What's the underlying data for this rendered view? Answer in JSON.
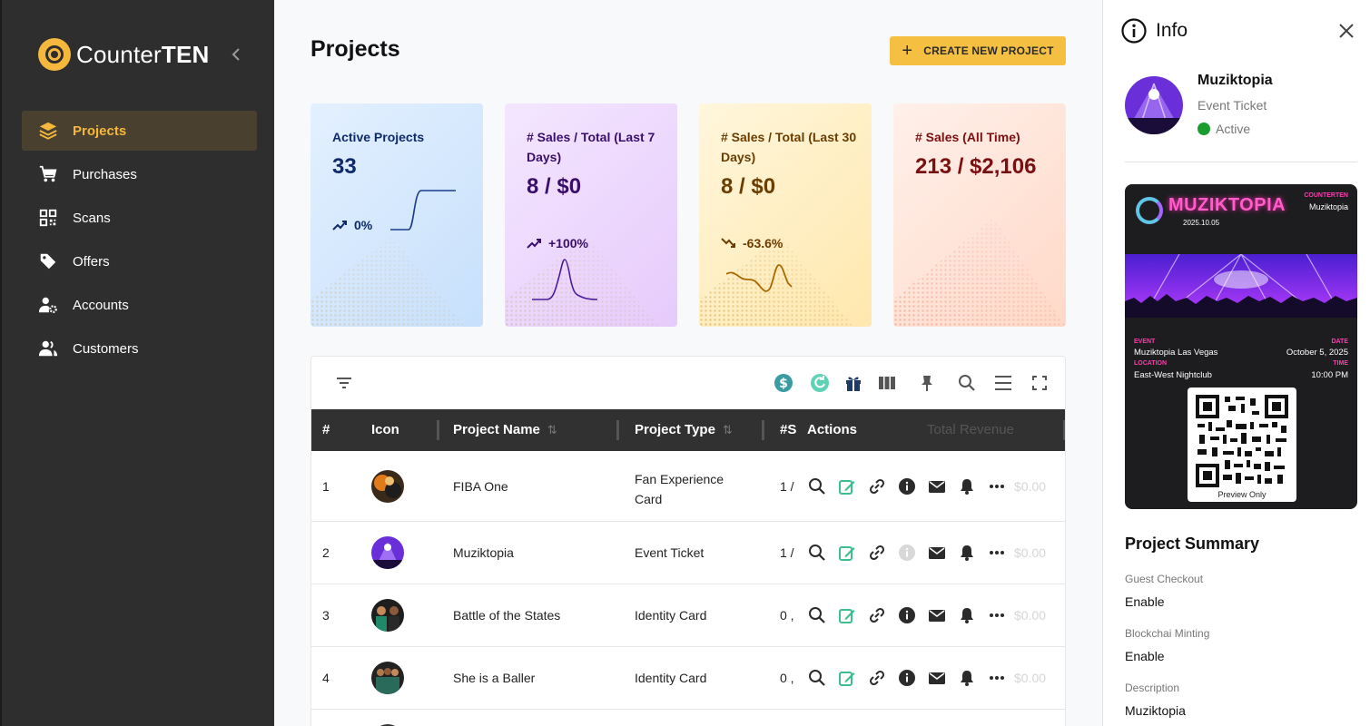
{
  "app": {
    "logo_light": "Counter",
    "logo_bold": "TEN"
  },
  "sidebar": {
    "items": [
      {
        "label": "Projects",
        "icon": "layers-icon",
        "active": true
      },
      {
        "label": "Purchases",
        "icon": "cart-icon"
      },
      {
        "label": "Scans",
        "icon": "qr-icon"
      },
      {
        "label": "Offers",
        "icon": "tag-icon"
      },
      {
        "label": "Accounts",
        "icon": "user-gear-icon"
      },
      {
        "label": "Customers",
        "icon": "users-icon"
      }
    ]
  },
  "header": {
    "title": "Projects",
    "create_label": "CREATE NEW PROJECT"
  },
  "stats": [
    {
      "title": "Active Projects",
      "value": "33",
      "delta": "0%"
    },
    {
      "title": "# Sales / Total (Last 7 Days)",
      "value": "8 / $0",
      "delta": "+100%"
    },
    {
      "title": "# Sales / Total (Last 30 Days)",
      "value": "8 / $0",
      "delta": "-63.6%"
    },
    {
      "title": "# Sales (All Time)",
      "value": "213 / $2,106"
    }
  ],
  "table": {
    "headers": {
      "num": "#",
      "icon": "Icon",
      "name": "Project Name",
      "type": "Project Type",
      "sales": "#S",
      "actions": "Actions",
      "revenue": "Total Revenue"
    },
    "rows": [
      {
        "num": "1",
        "name": "FIBA One",
        "type": "Fan Experience Card",
        "sales": "1 /",
        "ghost": "$0.00"
      },
      {
        "num": "2",
        "name": "Muziktopia",
        "type": "Event Ticket",
        "sales": "1 /",
        "ghost": "$0.00"
      },
      {
        "num": "3",
        "name": "Battle of the States",
        "type": "Identity Card",
        "sales": "0 ,",
        "ghost": "$0.00"
      },
      {
        "num": "4",
        "name": "She is a Baller",
        "type": "Identity Card",
        "sales": "0 ,",
        "ghost": "$0.00"
      }
    ]
  },
  "info": {
    "title": "Info",
    "name": "Muziktopia",
    "type": "Event Ticket",
    "status": "Active",
    "ticket": {
      "brand": "MUZIKTOPIA",
      "date_code": "2025.10.05",
      "issuer_label": "COUNTERTEN",
      "issuer": "Muziktopia",
      "event_label": "EVENT",
      "event": "Muziktopia Las Vegas",
      "date_label": "DATE",
      "date": "October 5, 2025",
      "location_label": "LOCATION",
      "location": "East-West Nightclub",
      "time_label": "TIME",
      "time": "10:00 PM",
      "qr_caption": "Preview Only"
    },
    "summary_title": "Project Summary",
    "summary": [
      {
        "label": "Guest Checkout",
        "value": "Enable"
      },
      {
        "label": "Blockchai Minting",
        "value": "Enable"
      },
      {
        "label": "Description",
        "value": "Muziktopia"
      }
    ]
  }
}
